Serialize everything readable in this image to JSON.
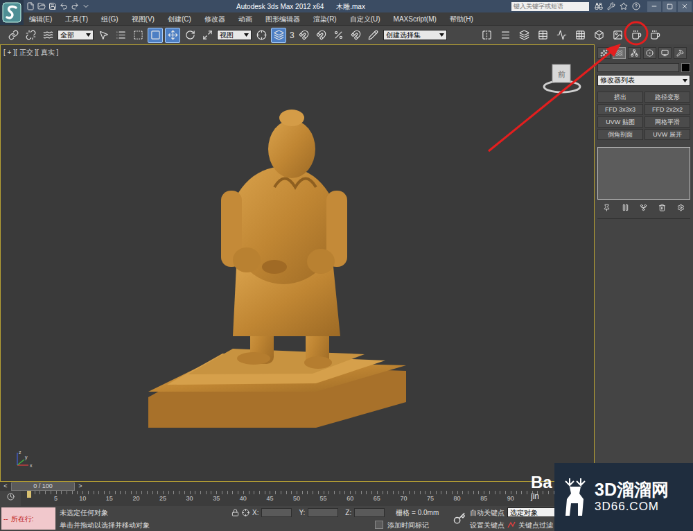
{
  "window": {
    "title": "Autodesk 3ds Max  2012 x64",
    "file": "木雕.max",
    "search_placeholder": "键入关键字或短语"
  },
  "menu": [
    "编辑(E)",
    "工具(T)",
    "组(G)",
    "视图(V)",
    "创建(C)",
    "修改器",
    "动画",
    "图形编辑器",
    "渲染(R)",
    "自定义(U)",
    "MAXScript(M)",
    "帮助(H)"
  ],
  "toolbar": {
    "selection_filter": "全部",
    "reference_coord": "视图",
    "snap_label": "3",
    "named_selection": "创建选择集",
    "tools": [
      {
        "selected": false
      },
      {
        "selected": false
      },
      {
        "selected": false
      },
      {
        "selected": false
      },
      {
        "selected": false
      },
      {
        "selected": false
      },
      {
        "selected": true
      },
      {
        "selected": true
      },
      {
        "selected": false
      },
      {
        "selected": false
      },
      {
        "selected": false
      },
      {
        "selected": true
      },
      {
        "selected": false
      },
      {
        "selected": false
      },
      {
        "selected": false
      },
      {
        "selected": false
      },
      {
        "selected": false
      },
      {
        "selected": false
      },
      {
        "selected": false
      },
      {
        "selected": false
      },
      {
        "selected": false
      },
      {
        "selected": false
      },
      {
        "selected": false
      },
      {
        "selected": false
      },
      {
        "selected": false
      },
      {
        "selected": false
      },
      {
        "selected": false
      }
    ]
  },
  "viewport": {
    "label": "[ + ][ 正交 ][ 真实 ]",
    "viewcube": "前",
    "axes": [
      "x",
      "y",
      "z"
    ]
  },
  "command_panel": {
    "tabs": [
      {
        "selected": false
      },
      {
        "selected": true
      },
      {
        "selected": false
      },
      {
        "selected": false
      },
      {
        "selected": false
      },
      {
        "selected": false
      }
    ],
    "modifier_list": "修改器列表",
    "buttons": [
      "挤出",
      "路径变形",
      "FFD 3x3x3",
      "FFD 2x2x2",
      "UVW 贴图",
      "网格平滑",
      "倒角剖面",
      "UVW 展开"
    ]
  },
  "timeline": {
    "position": "0 / 100",
    "prev": "<",
    "next": ">",
    "ticks": [
      "5",
      "10",
      "15",
      "20",
      "25",
      "30",
      "35",
      "40",
      "45",
      "50",
      "55",
      "60",
      "65",
      "70",
      "75",
      "80",
      "85",
      "90"
    ]
  },
  "status_bar": {
    "script_prefix": "--",
    "script_label": "所在行:",
    "prompt": "未选定任何对象",
    "hint": "单击并拖动以选择并移动对象",
    "x_label": "X:",
    "y_label": "Y:",
    "z_label": "Z:",
    "grid": "栅格 = 0.0mm",
    "add_time_tag": "添加时间标记",
    "auto_key": "自动关键点",
    "key_mode": "选定对象",
    "set_key": "设置关键点",
    "key_filters": "关键点过滤"
  },
  "watermarks": {
    "site_name": "3D溜溜网",
    "site_url": "3D66.COM",
    "baidu_top": "Ba",
    "baidu_bottom": "jin"
  }
}
